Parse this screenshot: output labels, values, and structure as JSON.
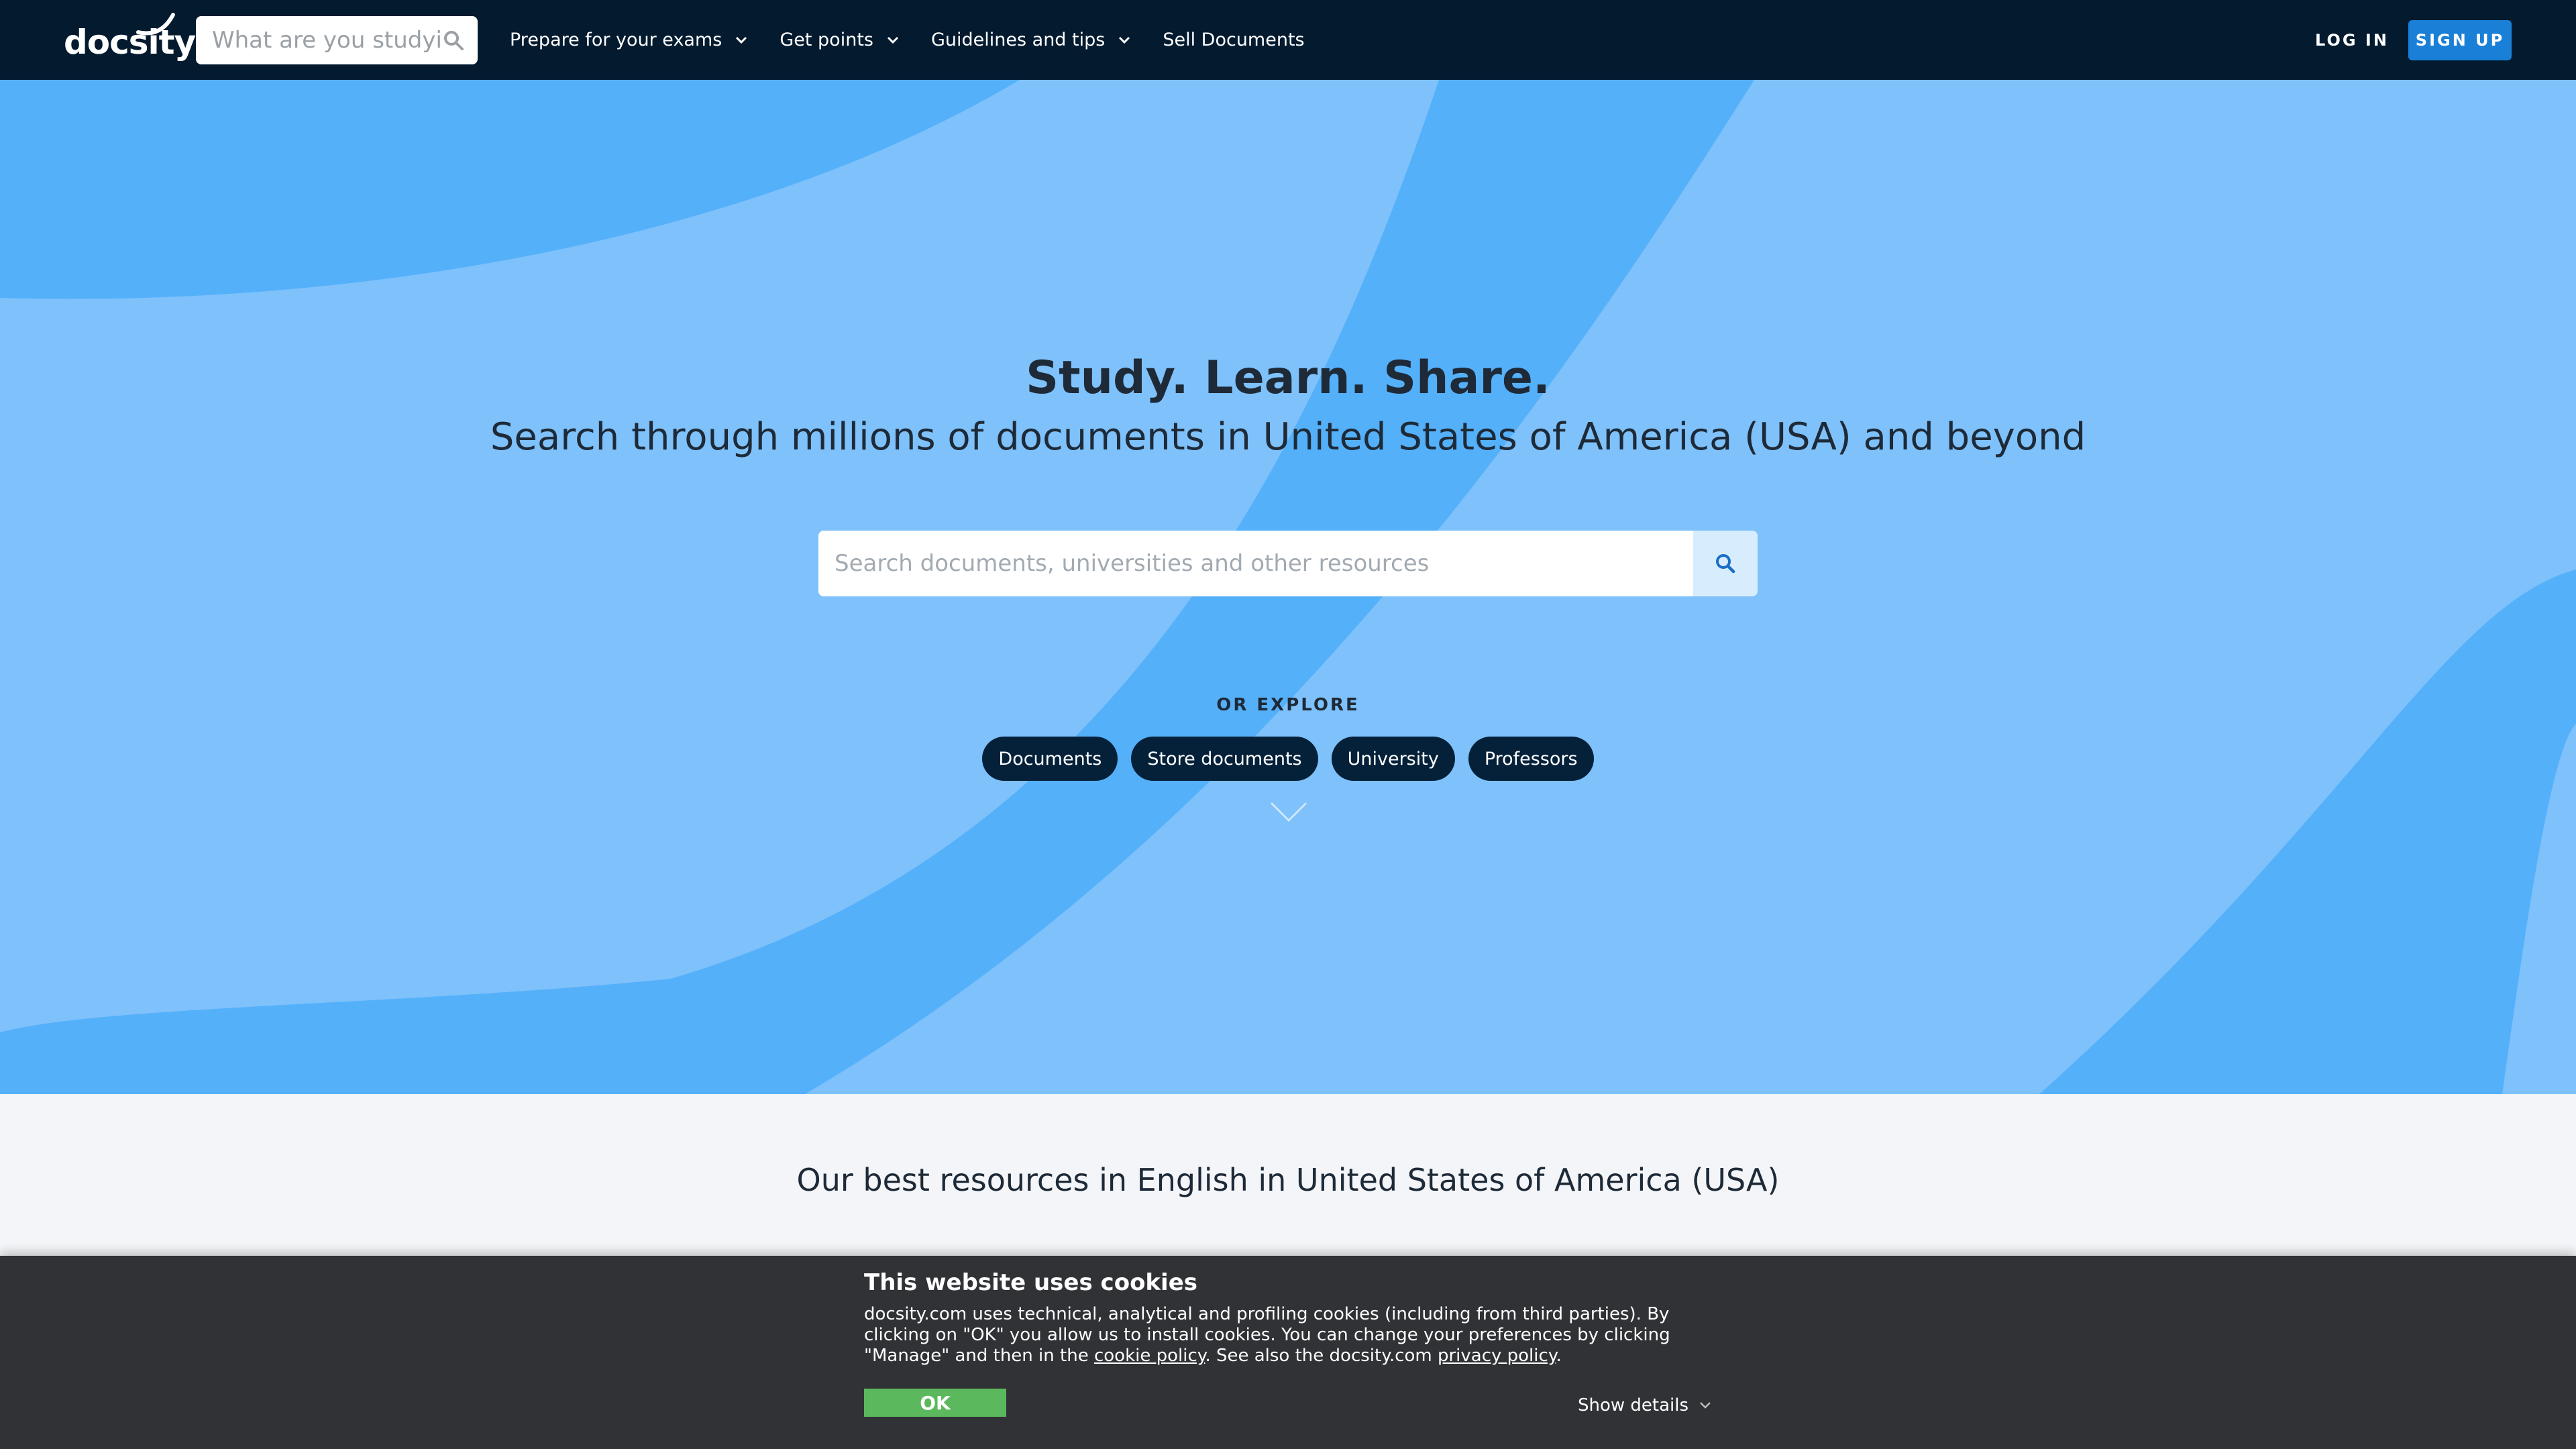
{
  "header": {
    "logo_text": "docsity",
    "search_placeholder": "What are you studying",
    "nav": [
      {
        "label": "Prepare for your exams",
        "dropdown": true
      },
      {
        "label": "Get points",
        "dropdown": true
      },
      {
        "label": "Guidelines and tips",
        "dropdown": true
      },
      {
        "label": "Sell Documents",
        "dropdown": false
      }
    ],
    "login_label": "LOG IN",
    "signup_label": "SIGN UP"
  },
  "hero": {
    "title": "Study. Learn. Share.",
    "subtitle": "Search through millions of documents in United States of America (USA) and beyond",
    "search_placeholder": "Search documents, universities and other resources",
    "explore_label": "OR EXPLORE",
    "chips": [
      "Documents",
      "Store documents",
      "University",
      "Professors"
    ]
  },
  "resources": {
    "title": "Our best resources in English in United States of America (USA)"
  },
  "cookie_banner": {
    "title": "This website uses cookies",
    "text_before_cookie_link": "docsity.com uses technical, analytical and profiling cookies (including from third parties). By clicking on \"OK\" you allow us to install cookies. You can change your preferences by clicking \"Manage\" and then in the ",
    "cookie_link": "cookie policy",
    "text_between_links": ". See also the docsity.com ",
    "privacy_link": "privacy policy",
    "text_end": ".",
    "ok_label": "OK",
    "details_label": "Show details"
  },
  "colors": {
    "topbar": "#031a2f",
    "hero_light": "#7ec1fb",
    "hero_dark": "#55b0fa",
    "accent": "#1a7fd6",
    "chip": "#052139",
    "cookie_bg": "#303236",
    "ok_green": "#5cb85c"
  }
}
